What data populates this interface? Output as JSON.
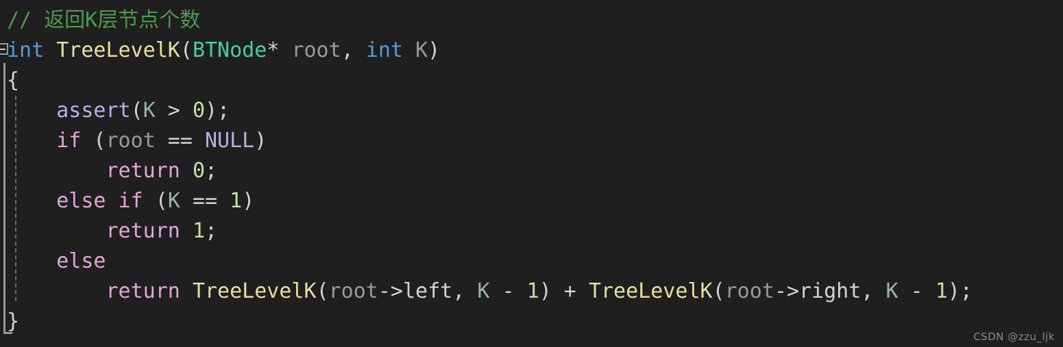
{
  "editor": {
    "background_color": "#1f1f1f",
    "theme_name": "dark",
    "watermark": "CSDN @zzu_ljk",
    "fold_marker_label": "−"
  },
  "colors": {
    "background": "#1f1f1f",
    "comment": "#4d9a4d",
    "keyword": "#e0a7d8",
    "type_keyword": "#569cd6",
    "user_type": "#4ec9a4",
    "function": "#e6e0a0",
    "macro": "#b4b0e8",
    "parameter": "#9a9a96",
    "variable": "#9ab4b0",
    "number": "#c5e1a5",
    "plain": "#d4d4d4",
    "gutter_rule": "#9a9a9a",
    "indent_guide": "#6e6e6e",
    "watermark": "#8a8a8a"
  },
  "code": {
    "language": "c",
    "lines": [
      {
        "index": 1,
        "text": "// 返回K层节点个数",
        "tokens": [
          {
            "t": "// ",
            "c": "comment"
          },
          {
            "t": "返回K层节点个数",
            "c": "comment-cjk"
          }
        ]
      },
      {
        "index": 2,
        "text": "int TreeLevelK(BTNode* root, int K)",
        "tokens": [
          {
            "t": "int",
            "c": "type-kw"
          },
          {
            "t": " ",
            "c": "plain"
          },
          {
            "t": "TreeLevelK",
            "c": "func"
          },
          {
            "t": "(",
            "c": "plain"
          },
          {
            "t": "BTNode",
            "c": "usertype"
          },
          {
            "t": "* ",
            "c": "plain"
          },
          {
            "t": "root",
            "c": "param"
          },
          {
            "t": ", ",
            "c": "plain"
          },
          {
            "t": "int",
            "c": "type-kw"
          },
          {
            "t": " ",
            "c": "plain"
          },
          {
            "t": "K",
            "c": "param"
          },
          {
            "t": ")",
            "c": "plain"
          }
        ]
      },
      {
        "index": 3,
        "text": "{",
        "tokens": [
          {
            "t": "{",
            "c": "plain"
          }
        ]
      },
      {
        "index": 4,
        "text": "    assert(K > 0);",
        "tokens": [
          {
            "t": "    ",
            "c": "plain"
          },
          {
            "t": "assert",
            "c": "macro"
          },
          {
            "t": "(",
            "c": "plain"
          },
          {
            "t": "K",
            "c": "var"
          },
          {
            "t": " > ",
            "c": "op"
          },
          {
            "t": "0",
            "c": "number"
          },
          {
            "t": ");",
            "c": "plain"
          }
        ]
      },
      {
        "index": 5,
        "text": "    if (root == NULL)",
        "tokens": [
          {
            "t": "    ",
            "c": "plain"
          },
          {
            "t": "if",
            "c": "keyword"
          },
          {
            "t": " (",
            "c": "plain"
          },
          {
            "t": "root",
            "c": "param"
          },
          {
            "t": " == ",
            "c": "op"
          },
          {
            "t": "NULL",
            "c": "macro"
          },
          {
            "t": ")",
            "c": "plain"
          }
        ]
      },
      {
        "index": 6,
        "text": "        return 0;",
        "tokens": [
          {
            "t": "        ",
            "c": "plain"
          },
          {
            "t": "return",
            "c": "keyword"
          },
          {
            "t": " ",
            "c": "plain"
          },
          {
            "t": "0",
            "c": "number"
          },
          {
            "t": ";",
            "c": "plain"
          }
        ]
      },
      {
        "index": 7,
        "text": "    else if (K == 1)",
        "tokens": [
          {
            "t": "    ",
            "c": "plain"
          },
          {
            "t": "else",
            "c": "keyword"
          },
          {
            "t": " ",
            "c": "plain"
          },
          {
            "t": "if",
            "c": "keyword"
          },
          {
            "t": " (",
            "c": "plain"
          },
          {
            "t": "K",
            "c": "var"
          },
          {
            "t": " == ",
            "c": "op"
          },
          {
            "t": "1",
            "c": "number"
          },
          {
            "t": ")",
            "c": "plain"
          }
        ]
      },
      {
        "index": 8,
        "text": "        return 1;",
        "tokens": [
          {
            "t": "        ",
            "c": "plain"
          },
          {
            "t": "return",
            "c": "keyword"
          },
          {
            "t": " ",
            "c": "plain"
          },
          {
            "t": "1",
            "c": "number"
          },
          {
            "t": ";",
            "c": "plain"
          }
        ]
      },
      {
        "index": 9,
        "text": "    else",
        "tokens": [
          {
            "t": "    ",
            "c": "plain"
          },
          {
            "t": "else",
            "c": "keyword"
          }
        ]
      },
      {
        "index": 10,
        "text": "        return TreeLevelK(root->left, K - 1) + TreeLevelK(root->right, K - 1);",
        "tokens": [
          {
            "t": "        ",
            "c": "plain"
          },
          {
            "t": "return",
            "c": "keyword"
          },
          {
            "t": " ",
            "c": "plain"
          },
          {
            "t": "TreeLevelK",
            "c": "func"
          },
          {
            "t": "(",
            "c": "plain"
          },
          {
            "t": "root",
            "c": "param"
          },
          {
            "t": "->",
            "c": "plain"
          },
          {
            "t": "left",
            "c": "plain"
          },
          {
            "t": ", ",
            "c": "plain"
          },
          {
            "t": "K",
            "c": "var"
          },
          {
            "t": " - ",
            "c": "op"
          },
          {
            "t": "1",
            "c": "number"
          },
          {
            "t": ") + ",
            "c": "plain"
          },
          {
            "t": "TreeLevelK",
            "c": "func"
          },
          {
            "t": "(",
            "c": "plain"
          },
          {
            "t": "root",
            "c": "param"
          },
          {
            "t": "->",
            "c": "plain"
          },
          {
            "t": "right",
            "c": "plain"
          },
          {
            "t": ", ",
            "c": "plain"
          },
          {
            "t": "K",
            "c": "var"
          },
          {
            "t": " - ",
            "c": "op"
          },
          {
            "t": "1",
            "c": "number"
          },
          {
            "t": ");",
            "c": "plain"
          }
        ]
      },
      {
        "index": 11,
        "text": "}",
        "tokens": [
          {
            "t": "}",
            "c": "plain"
          }
        ]
      }
    ]
  }
}
